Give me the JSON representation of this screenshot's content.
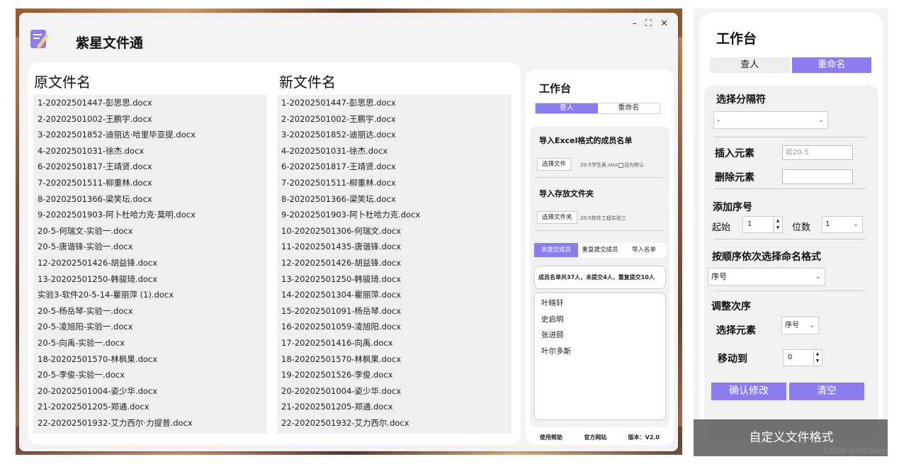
{
  "app": {
    "title": "紫星文件通",
    "window_controls": {
      "minimize": "–",
      "maximize": "⛶",
      "close": "✕"
    }
  },
  "files": {
    "original_header": "原文件名",
    "new_header": "新文件名",
    "original": [
      "1-20202501447-彭思思.docx",
      "2-20202501002-王鹏宇.docx",
      "3-20202501852-迪丽达·哈里毕亚提.docx",
      "4-20202501031-徐杰.docx",
      "6-20202501817-王靖贤.docx",
      "7-20202501511-柳重林.docx",
      "8-20202501366-梁笑坛.docx",
      "9-20202501903-阿卜杜哈力克·莫明.docx",
      "20-5-何瑞文-实验一.docx",
      "20-5-唐谐锋-实验一.docx",
      "12-20202501426-胡益锋.docx",
      "13-20202501250-韩骏琦.docx",
      "实验3-软件20-5-14-瞿丽萍 (1).docx",
      "20-5-杨岳琴-实验一.docx",
      "20-5-凌旭阳-实验一.docx",
      "20-5-向禹-实验一.docx",
      "18-20202501570-林枫果.docx",
      "20-5-李俊-实验一.docx",
      "20-20202501004-姿少华.docx",
      "21-20202501205-郑通.docx",
      "22-20202501932-艾力西尔·力提普.docx"
    ],
    "renamed": [
      "1-20202501447-彭思思.docx",
      "2-20202501002-王鹏宇.docx",
      "3-20202501852-迪丽达.docx",
      "4-20202501031-徐杰.docx",
      "6-20202501817-王靖贤.docx",
      "7-20202501511-柳重林.docx",
      "8-20202501366-梁笑坛.docx",
      "9-20202501903-阿卜杜哈力克.docx",
      "10-20202501306-何瑞文.docx",
      "11-20202501435-唐谐锋.docx",
      "12-20202501426-胡益锋.docx",
      "13-20202501250-韩骏琦.docx",
      "14-20202501304-瞿丽萍.docx",
      "15-20202501091-杨岳琴.docx",
      "16-20202501059-凌旭阳.docx",
      "17-20202501416-向禹.docx",
      "18-20202501570-林枫果.docx",
      "19-20202501526-李俊.docx",
      "20-20202501004-姿少华.docx",
      "21-20202501205-郑通.docx",
      "22-20202501932-艾力西尔.docx"
    ]
  },
  "workbench": {
    "title": "工作台",
    "tabs": {
      "lookup": "查人",
      "rename": "重命名"
    },
    "excel_title": "导入Excel格式的成员名单",
    "choose_file_btn": "选择文件",
    "file_name": "20-5学生表.xlsx",
    "set_default": "设为默认",
    "folder_title": "导入存放文件夹",
    "choose_folder_btn": "选择文件夹",
    "folder_name": "20-5软件工程实验三",
    "subtabs": {
      "not_submitted": "未提交成员",
      "duplicate": "重复提交成员",
      "import": "导入名单"
    },
    "summary": "成员名单共37人，未提交4人，重复提交10人",
    "members": [
      "叶晓轩",
      "史启明",
      "张进颐",
      "叶尔多斯"
    ],
    "footer": {
      "help": "使用帮助",
      "site": "官方网站",
      "version": "版本：V2.0"
    }
  },
  "rename_panel": {
    "title": "工作台",
    "tabs": {
      "lookup": "查人",
      "rename": "重命名"
    },
    "separator_label": "选择分隔符",
    "separator_value": "-",
    "insert_label": "插入元素",
    "insert_placeholder": "如20-5",
    "delete_label": "删除元素",
    "delete_value": "",
    "serial_label": "添加序号",
    "start_label": "起始",
    "start_value": "1",
    "digits_label": "位数",
    "digits_value": "1",
    "format_label": "按顺序依次选择命名格式",
    "format_value": "序号",
    "order_label": "调整次序",
    "select_elem_label": "选择元素",
    "select_elem_value": "序号",
    "move_to_label": "移动到",
    "move_to_value": "0",
    "confirm_btn": "确认修改",
    "clear_btn": "清空",
    "caption": "自定义文件格式"
  },
  "watermark": "CSDN @falldeep",
  "colors": {
    "accent": "#8b7df0",
    "panel_bg": "#f1f1f1"
  }
}
